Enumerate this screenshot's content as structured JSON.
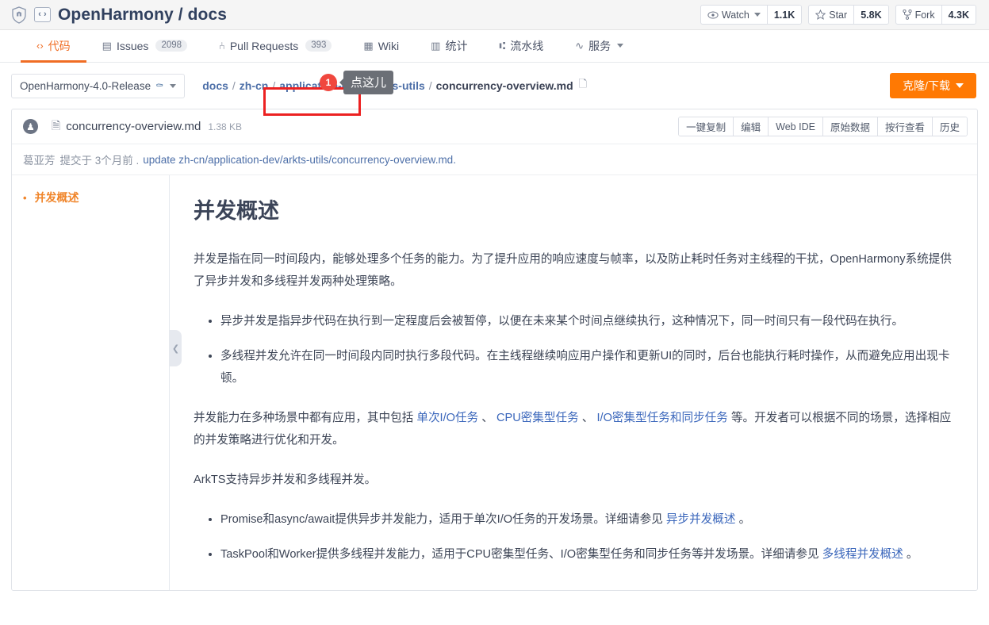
{
  "header": {
    "shield_icon": "shield-icon",
    "repo_icon": "code-brackets-icon",
    "repo_full_name": "OpenHarmony / docs",
    "watch": {
      "icon": "eye-icon",
      "label": "Watch",
      "count": "1.1K"
    },
    "star": {
      "icon": "star-icon",
      "label": "Star",
      "count": "5.8K"
    },
    "fork": {
      "icon": "fork-icon",
      "label": "Fork",
      "count": "4.3K"
    }
  },
  "nav": {
    "tabs": [
      {
        "icon": "code-icon",
        "glyph": "‹›",
        "label": "代码",
        "count": "",
        "active": true
      },
      {
        "icon": "issue-icon",
        "glyph": "▤",
        "label": "Issues",
        "count": "2098",
        "active": false
      },
      {
        "icon": "pull-request-icon",
        "glyph": "⑃",
        "label": "Pull Requests",
        "count": "393",
        "active": false
      },
      {
        "icon": "wiki-icon",
        "glyph": "▦",
        "label": "Wiki",
        "count": "",
        "active": false
      },
      {
        "icon": "chart-icon",
        "glyph": "▥",
        "label": "统计",
        "count": "",
        "active": false
      },
      {
        "icon": "pipeline-icon",
        "glyph": "⑆",
        "label": "流水线",
        "count": "",
        "active": false
      },
      {
        "icon": "service-icon",
        "glyph": "∿",
        "label": "服务",
        "count": "",
        "active": false,
        "has_caret": true
      }
    ]
  },
  "pathbar": {
    "branch": {
      "label": "OpenHarmony-4.0-Release",
      "lock_icon": "lock-shield-icon",
      "caret_icon": "chevron-down-icon"
    },
    "breadcrumb": [
      {
        "label": "docs",
        "link": true
      },
      {
        "label": "zh-cn",
        "link": true
      },
      {
        "label": "application-dev",
        "link": true,
        "highlighted": true
      },
      {
        "label": "arkts-utils",
        "link": true
      },
      {
        "label": "concurrency-overview.md",
        "link": false
      }
    ],
    "separator": "/",
    "copy_path_icon": "copy-icon",
    "clone_button": {
      "label": "克隆/下载",
      "caret_icon": "chevron-down-icon",
      "color": "#ff7903"
    },
    "annotation": {
      "badge": "1",
      "tooltip": "点这儿",
      "box_color": "#ec2121"
    }
  },
  "file": {
    "avatar_icon": "user-avatar-icon",
    "type_icon": "markdown-file-icon",
    "name": "concurrency-overview.md",
    "size": "1.38 KB",
    "actions": [
      {
        "label": "一键复制"
      },
      {
        "label": "编辑"
      },
      {
        "label": "Web IDE"
      },
      {
        "label": "原始数据"
      },
      {
        "label": "按行查看"
      },
      {
        "label": "历史"
      }
    ],
    "commit": {
      "author": "葛亚芳",
      "meta": "提交于 3个月前 .",
      "message": "update zh-cn/application-dev/arkts-utils/concurrency-overview.md."
    }
  },
  "toc": {
    "items": [
      {
        "label": "并发概述",
        "bullet": "•"
      }
    ],
    "collapse_icon": "chevron-left-icon"
  },
  "article": {
    "title": "并发概述",
    "p1": "并发是指在同一时间段内，能够处理多个任务的能力。为了提升应用的响应速度与帧率，以及防止耗时任务对主线程的干扰，OpenHarmony系统提供了异步并发和多线程并发两种处理策略。",
    "list1": [
      "异步并发是指异步代码在执行到一定程度后会被暂停，以便在未来某个时间点继续执行，这种情况下，同一时间只有一段代码在执行。",
      "多线程并发允许在同一时间段内同时执行多段代码。在主线程继续响应用户操作和更新UI的同时，后台也能执行耗时操作，从而避免应用出现卡顿。"
    ],
    "p2_a": "并发能力在多种场景中都有应用，其中包括",
    "p2_link1": "单次I/O任务",
    "p2_b": "、",
    "p2_link2": "CPU密集型任务",
    "p2_c": "、",
    "p2_link3": "I/O密集型任务和同步任务",
    "p2_d": "等。开发者可以根据不同的场景，选择相应的并发策略进行优化和开发。",
    "p3": "ArkTS支持异步并发和多线程并发。",
    "li3_a": "Promise和async/await提供异步并发能力，适用于单次I/O任务的开发场景。详细请参见",
    "li3_link": "异步并发概述",
    "li3_b": "。",
    "li4_a": "TaskPool和Worker提供多线程并发能力，适用于CPU密集型任务、I/O密集型任务和同步任务等并发场景。详细请参见",
    "li4_link": "多线程并发概述",
    "li4_b": "。"
  }
}
